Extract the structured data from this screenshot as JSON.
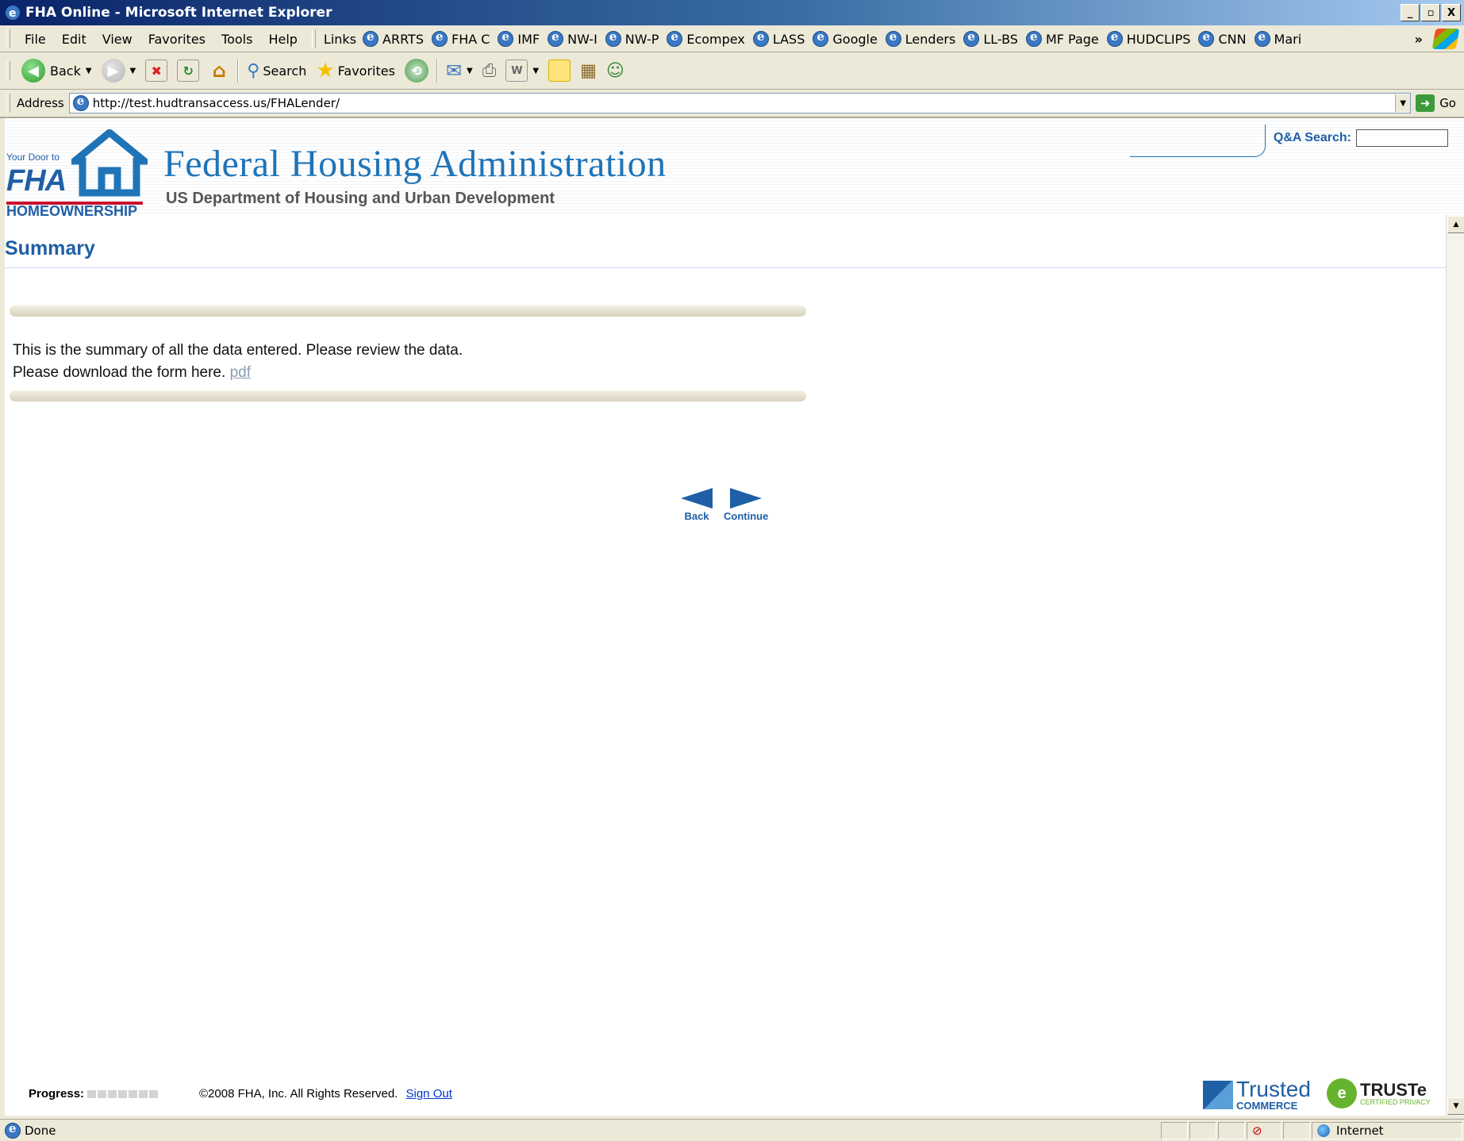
{
  "window": {
    "title": "FHA Online - Microsoft Internet Explorer",
    "controls": [
      "_",
      "▫",
      "X"
    ]
  },
  "menu": [
    "File",
    "Edit",
    "View",
    "Favorites",
    "Tools",
    "Help"
  ],
  "links": {
    "label": "Links",
    "items": [
      "ARRTS",
      "FHA C",
      "IMF",
      "NW-I",
      "NW-P",
      "Ecompex",
      "LASS",
      "Google",
      "Lenders",
      "LL-BS",
      "MF Page",
      "HUDCLIPS",
      "CNN",
      "Mari"
    ],
    "overflow": "»"
  },
  "toolbar": {
    "back": "Back",
    "search": "Search",
    "favorites": "Favorites"
  },
  "address": {
    "label": "Address",
    "url": "http://test.hudtransaccess.us/FHALender/",
    "go": "Go"
  },
  "header": {
    "logo_top": "Your Door to",
    "logo_main": "FHA",
    "logo_bottom": "HOMEOWNERSHIP",
    "agency": "Federal Housing Administration",
    "department": "US Department of Housing and Urban Development",
    "qa_label": "Q&A Search:"
  },
  "page": {
    "title": "Summary",
    "message_line1": "This is the summary of all the data entered. Please review the data.",
    "message_line2": "Please download the form here.",
    "pdf_link": "pdf",
    "back_label": "Back",
    "continue_label": "Continue"
  },
  "footer": {
    "progress_label": "Progress:",
    "progress_steps": 7,
    "copyright": "©2008 FHA, Inc. All Rights Reserved.",
    "signout": "Sign Out",
    "trusted_line1": "Trusted",
    "trusted_line2": "COMMERCE",
    "truste_line1": "TRUSTe",
    "truste_line2": "CERTIFIED PRIVACY"
  },
  "status": {
    "text": "Done",
    "zone": "Internet"
  }
}
